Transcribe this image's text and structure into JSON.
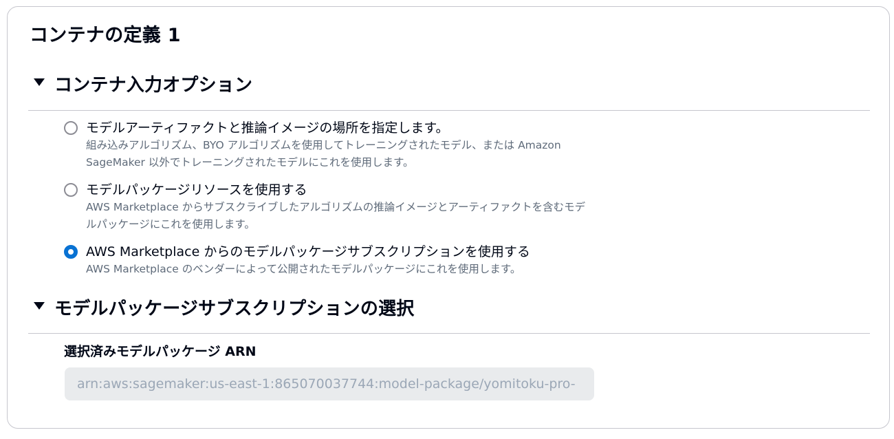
{
  "card": {
    "title": "コンテナの定義 1"
  },
  "section_input_options": {
    "title": "コンテナ入力オプション",
    "options": [
      {
        "label": "モデルアーティファクトと推論イメージの場所を指定します。",
        "description": "組み込みアルゴリズム、BYO アルゴリズムを使用してトレーニングされたモデル、または Amazon SageMaker 以外でトレーニングされたモデルにこれを使用します。",
        "selected": false
      },
      {
        "label": "モデルパッケージリソースを使用する",
        "description": "AWS Marketplace からサブスクライブしたアルゴリズムの推論イメージとアーティファクトを含むモデルパッケージにこれを使用します。",
        "selected": false
      },
      {
        "label": "AWS Marketplace からのモデルパッケージサブスクリプションを使用する",
        "description": "AWS Marketplace のベンダーによって公開されたモデルパッケージにこれを使用します。",
        "selected": true
      }
    ]
  },
  "section_subscription": {
    "title": "モデルパッケージサブスクリプションの選択",
    "arn_label": "選択済みモデルパッケージ ARN",
    "arn_value": "arn:aws:sagemaker:us-east-1:865070037744:model-package/yomitoku-pro-"
  },
  "colors": {
    "accent": "#0972d3",
    "border": "#c6c6cd",
    "text": "#000716",
    "secondary_text": "#5f6b7a",
    "disabled_bg": "#e9ebed"
  }
}
